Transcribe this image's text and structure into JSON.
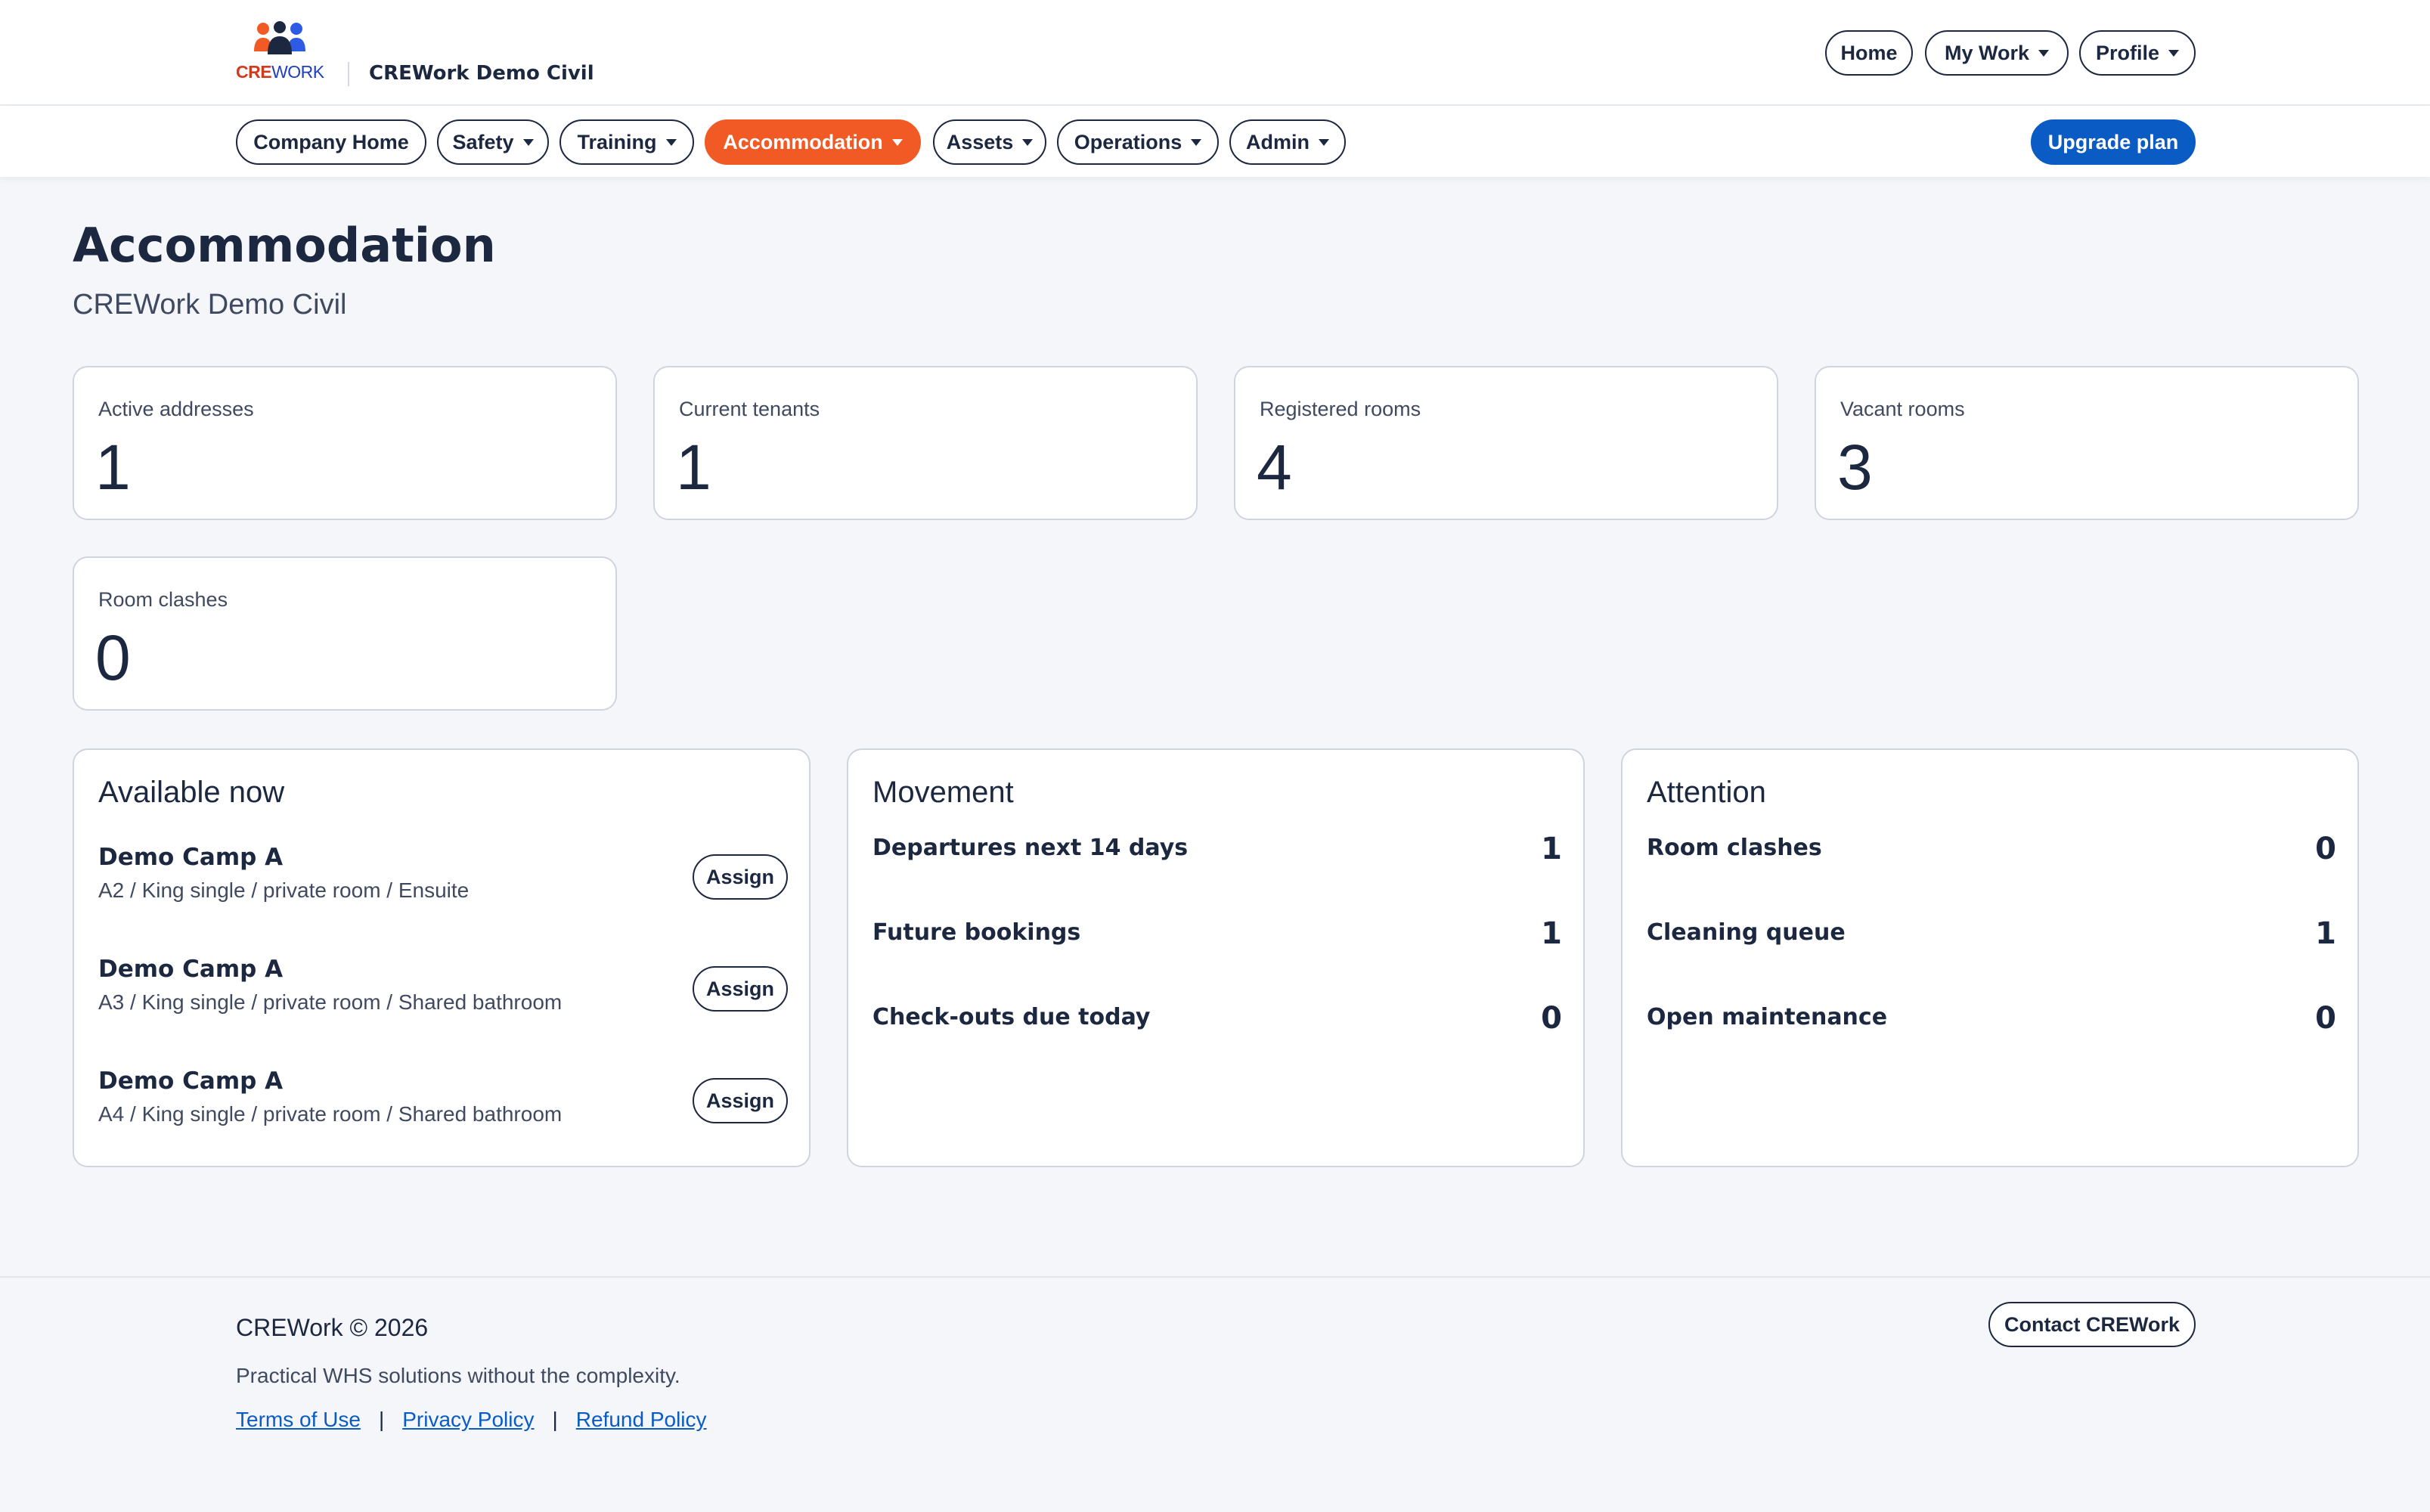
{
  "brand": {
    "logo_cre": "CRE",
    "logo_work": "WORK",
    "company_name": "CREWork Demo Civil",
    "colors": {
      "orange": "#f15a24",
      "navy": "#1c2740",
      "blue": "#0a5bc4"
    }
  },
  "top_nav": {
    "home": "Home",
    "my_work": "My Work",
    "profile": "Profile"
  },
  "main_nav": {
    "items": [
      {
        "label": "Company Home",
        "has_dropdown": false
      },
      {
        "label": "Safety",
        "has_dropdown": true
      },
      {
        "label": "Training",
        "has_dropdown": true
      },
      {
        "label": "Accommodation",
        "has_dropdown": true,
        "active": true
      },
      {
        "label": "Assets",
        "has_dropdown": true
      },
      {
        "label": "Operations",
        "has_dropdown": true
      },
      {
        "label": "Admin",
        "has_dropdown": true
      }
    ],
    "upgrade": "Upgrade plan"
  },
  "page": {
    "title": "Accommodation",
    "subtitle": "CREWork Demo Civil"
  },
  "stats": [
    {
      "label": "Active addresses",
      "value": "1"
    },
    {
      "label": "Current tenants",
      "value": "1"
    },
    {
      "label": "Registered rooms",
      "value": "4"
    },
    {
      "label": "Vacant rooms",
      "value": "3"
    },
    {
      "label": "Room clashes",
      "value": "0"
    }
  ],
  "available": {
    "title": "Available now",
    "assign_label": "Assign",
    "items": [
      {
        "name": "Demo Camp A",
        "desc": "A2 / King single / private room / Ensuite"
      },
      {
        "name": "Demo Camp A",
        "desc": "A3 / King single / private room / Shared bathroom"
      },
      {
        "name": "Demo Camp A",
        "desc": "A4 / King single / private room / Shared bathroom"
      }
    ]
  },
  "movement": {
    "title": "Movement",
    "rows": [
      {
        "label": "Departures next 14 days",
        "value": "1"
      },
      {
        "label": "Future bookings",
        "value": "1"
      },
      {
        "label": "Check-outs due today",
        "value": "0"
      }
    ]
  },
  "attention": {
    "title": "Attention",
    "rows": [
      {
        "label": "Room clashes",
        "value": "0"
      },
      {
        "label": "Cleaning queue",
        "value": "1"
      },
      {
        "label": "Open maintenance",
        "value": "0"
      }
    ]
  },
  "footer": {
    "copyright": "CREWork © 2026",
    "tagline": "Practical WHS solutions without the complexity.",
    "links": [
      "Terms of Use",
      "Privacy Policy",
      "Refund Policy"
    ],
    "separator": "|",
    "contact": "Contact CREWork"
  }
}
